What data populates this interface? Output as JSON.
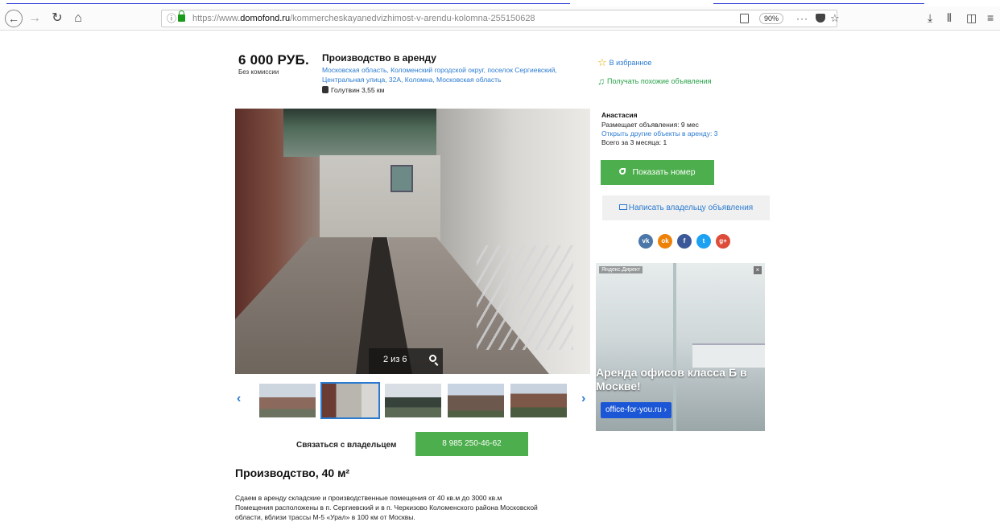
{
  "browser": {
    "url_prefix": "https://www.",
    "url_domain": "domofond.ru",
    "url_path": "/kommercheskayanedvizhimost-v-arendu-kolomna-255150628",
    "zoom": "90%"
  },
  "listing": {
    "price": "6 000 РУБ.",
    "commission": "Без комиссии",
    "title": "Производство в аренду",
    "address": "Московская область, Коломенский городской округ, поселок Сергиевский, Центральная улица, 32А, Коломна, Московская область",
    "metro": "Голутвин 3,55 км",
    "favorite_label": "В избранное",
    "similar_label": "Получать похожие объявления",
    "photo_counter": "2 из 6",
    "contact_label": "Связаться с владельцем",
    "phone": "8 985 250-46-62",
    "section_title": "Производство, 40 м²",
    "description_lines": [
      "Сдаем в аренду складские и производственные помещения от 40 кв.м до 3000 кв.м",
      "Помещения расположены в п. Сергиевский и в п. Черкизово Коломенского района Московской",
      "области, вблизи трассы М-5 «Урал» в 100 км от Москвы."
    ]
  },
  "seller": {
    "name": "Анастасия",
    "posting_since": "Размещает объявления: 9 мес",
    "other_link": "Открыть другие объекты в аренду: 3",
    "total": "Всего за 3 месяца: 1",
    "show_number": "Показать номер",
    "write_owner": "Написать владельцу объявления"
  },
  "social": [
    "vk",
    "ok",
    "fb",
    "tw",
    "g+"
  ],
  "ad": {
    "label": "Яндекс.Директ",
    "headline": "Аренда офисов класса Б в Москве!",
    "button": "office-for-you.ru ›"
  },
  "colors": {
    "accent_green": "#4cae4c",
    "link_blue": "#2a7bd0"
  }
}
